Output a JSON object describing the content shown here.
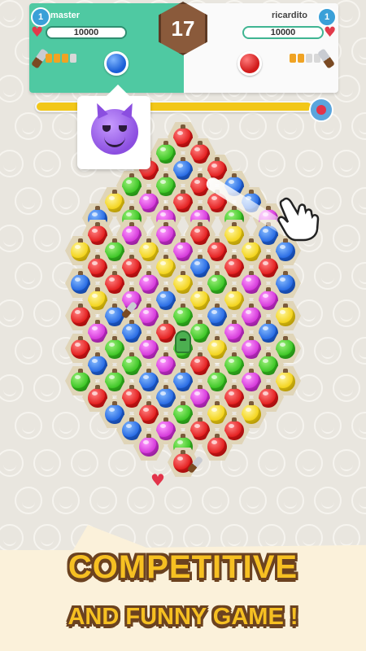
{
  "player_left": {
    "name": "master",
    "level": "1",
    "score": "10000",
    "energy_filled": 3,
    "energy_total": 4,
    "turn_color": "blue"
  },
  "player_right": {
    "name": "ricardito",
    "level": "1",
    "score": "10000",
    "energy_filled": 2,
    "energy_total": 4,
    "turn_color": "red"
  },
  "move_counter": "17",
  "timer": {
    "fill_fraction": 0.95
  },
  "emote": {
    "icon": "devil-emoji-icon"
  },
  "colors": {
    "panel_green": "#4fc9a2",
    "timer_yellow": "#f2c718",
    "title_yellow": "#f6c022",
    "title_outline": "#6b4220"
  },
  "board": {
    "rows": [
      [
        "red"
      ],
      [
        "green",
        "red"
      ],
      [
        "red",
        "blue",
        "red"
      ],
      [
        "green",
        "green",
        "red",
        "blue"
      ],
      [
        "yellow",
        "pink",
        "red",
        "red",
        "blue"
      ],
      [
        "blue",
        "green",
        "pink",
        "pink",
        "green",
        "pink"
      ],
      [
        "red",
        "pink",
        "pink",
        "red",
        "yellow",
        "blue"
      ],
      [
        "yellow",
        "green",
        "yellow",
        "pink",
        "red",
        "yellow",
        "blue"
      ],
      [
        "red",
        "red",
        "yellow",
        "blue",
        "red",
        "red"
      ],
      [
        "blue",
        "red",
        "pink",
        "yellow",
        "green",
        "pink",
        "blue"
      ],
      [
        "yellow",
        "pink",
        "blue",
        "yellow",
        "yellow",
        "pink"
      ],
      [
        "red",
        "blue",
        "pink",
        "green",
        "blue",
        "pink",
        "yellow"
      ],
      [
        "pink",
        "blue",
        "red",
        "green",
        "pink",
        "blue"
      ],
      [
        "red",
        "green",
        "pink",
        "green",
        "yellow",
        "pink",
        "green"
      ],
      [
        "blue",
        "green",
        "pink",
        "red",
        "green",
        "green"
      ],
      [
        "green",
        "green",
        "blue",
        "blue",
        "green",
        "pink",
        "yellow"
      ],
      [
        "red",
        "red",
        "blue",
        "pink",
        "red",
        "red"
      ],
      [
        "blue",
        "red",
        "green",
        "yellow",
        "yellow"
      ],
      [
        "blue",
        "pink",
        "red",
        "red"
      ],
      [
        "pink",
        "green",
        "red"
      ],
      [
        "red"
      ]
    ]
  },
  "footer": {
    "line1": "COMPETITIVE",
    "line2": "AND FUNNY GAME !"
  }
}
